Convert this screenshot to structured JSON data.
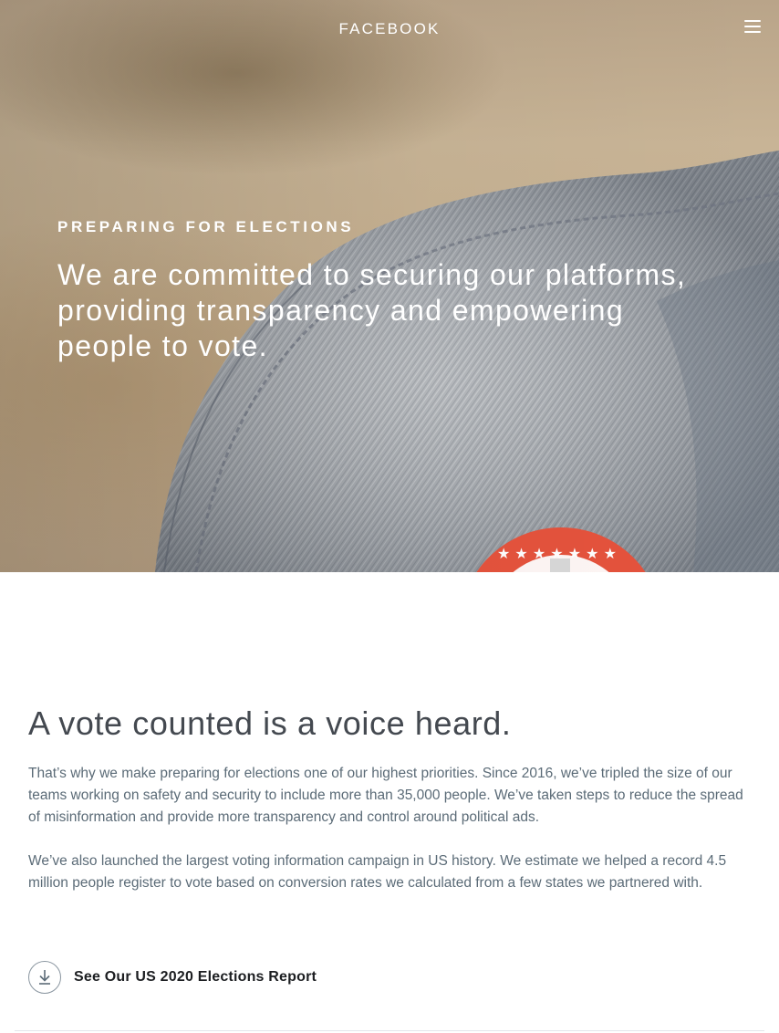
{
  "header": {
    "brand": "FACEBOOK",
    "menu_icon": "hamburger-menu-icon"
  },
  "hero": {
    "eyebrow": "PREPARING FOR ELECTIONS",
    "title": "We are committed to securing our platforms, providing transparency and empowering people to vote.",
    "image": "photo of denim jacket shoulder with red voting sticker"
  },
  "main": {
    "headline": "A vote counted is a voice heard.",
    "paragraphs": [
      "That’s why we make preparing for elections one of our highest priorities. Since 2016, we’ve tripled the size of our teams working on safety and security to include more than 35,000 people. We’ve taken steps to reduce the spread of misinformation and provide more transparency and control around political ads.",
      "We’ve also launched the largest voting information campaign in US history. We estimate we helped a record 4.5 million people register to vote based on conversion rates we calculated from a few states we partnered with."
    ],
    "report_link": {
      "label": "See Our US 2020 Elections Report",
      "icon": "download-icon"
    }
  },
  "colors": {
    "hero_text": "#ffffff",
    "headline": "#444950",
    "body_text": "#5b6b77",
    "sticker_red": "#e5533d"
  }
}
